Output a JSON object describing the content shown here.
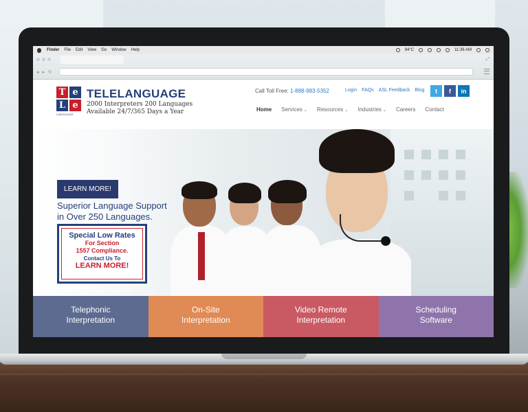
{
  "menubar": {
    "finder": "Finder",
    "items": [
      "File",
      "Edit",
      "View",
      "Go",
      "Window",
      "Help"
    ],
    "temp": "84°C",
    "time": "11:36 AM"
  },
  "site": {
    "logo_letters": [
      "Te",
      "le"
    ],
    "logo_tiles": [
      "T",
      "e",
      "L",
      "e"
    ],
    "logo_caption": "LANGUAGE",
    "brand_name": "TELELANGUAGE",
    "tagline_1": "2000 Interpreters 200 Languages",
    "tagline_2": "Available 24/7/365 Days a Year",
    "toll_label": "Call Toll Free:",
    "toll_number": "1-888-983-5352",
    "top_links": [
      "Login",
      "FAQs",
      "ASL Feedback",
      "Blog"
    ],
    "social": {
      "twitter": "t",
      "facebook": "f",
      "linkedin": "in"
    },
    "nav": [
      "Home",
      "Services",
      "Resources",
      "Industries",
      "Careers",
      "Contact"
    ]
  },
  "hero": {
    "title_1": "Superior Language Support",
    "title_2": "in Over 250 Languages.",
    "button": "LEARN MORE!"
  },
  "promo": {
    "line1": "Special Low Rates",
    "line2": "For Section",
    "line3": "1557 Compliance.",
    "line4": "Contact Us To",
    "line5": "LEARN MORE!"
  },
  "services": [
    {
      "line1": "Telephonic",
      "line2": "Interpretation",
      "color": "#5c6b8f"
    },
    {
      "line1": "On-Site",
      "line2": "Interpretation",
      "color": "#e08a55"
    },
    {
      "line1": "Video Remote",
      "line2": "Interpretation",
      "color": "#c95a63"
    },
    {
      "line1": "Scheduling",
      "line2": "Software",
      "color": "#8f74ab"
    }
  ],
  "colors": {
    "brand_blue": "#24407a",
    "brand_red": "#c81f2c",
    "link_blue": "#2a78c4"
  }
}
